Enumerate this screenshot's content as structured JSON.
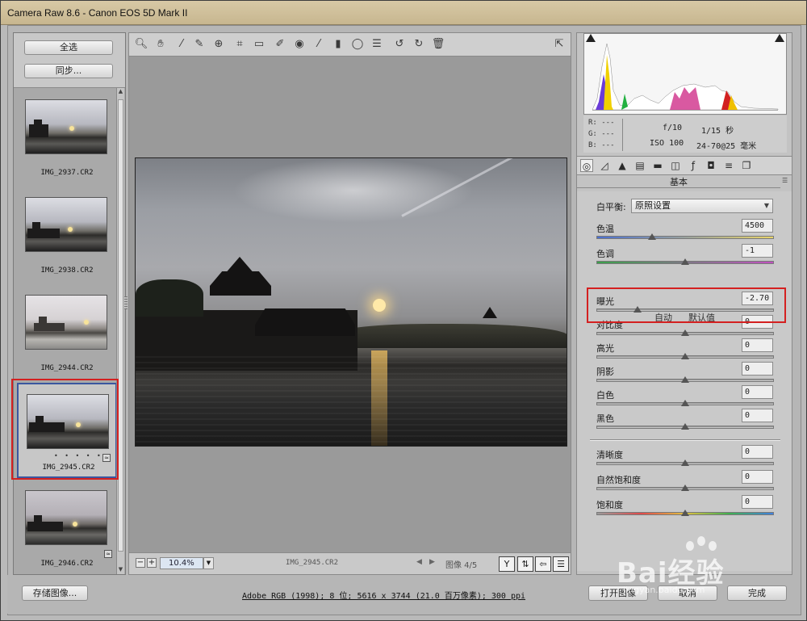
{
  "window": {
    "title": "Camera Raw 8.6 -  Canon EOS 5D Mark II"
  },
  "filmstrip": {
    "select_all_label": "全选",
    "sync_label": "同步...",
    "items": [
      {
        "name": "IMG_2937.CR2",
        "selected": false
      },
      {
        "name": "IMG_2938.CR2",
        "selected": false
      },
      {
        "name": "IMG_2944.CR2",
        "selected": false
      },
      {
        "name": "IMG_2945.CR2",
        "selected": true,
        "rating": "• • • • •"
      },
      {
        "name": "IMG_2946.CR2",
        "selected": false
      }
    ]
  },
  "toolbar": {
    "tools": [
      "zoom-tool",
      "hand-tool",
      "white-balance-tool",
      "color-sampler-tool",
      "targeted-adjustment-tool",
      "crop-tool",
      "straighten-tool",
      "spot-removal-tool",
      "red-eye-tool",
      "adjustment-brush",
      "graduated-filter",
      "radial-filter",
      "preferences",
      "rotate-left",
      "rotate-right",
      "delete"
    ]
  },
  "preview": {
    "zoom_value": "10.4%",
    "filename": "IMG_2945.CR2",
    "image_count": "图像 4/5"
  },
  "histogram": {
    "r": "R:  ---",
    "g": "G:  ---",
    "b": "B:  ---",
    "aperture": "f/10",
    "shutter": "1/15 秒",
    "iso": "ISO 100",
    "lens": "24-70@25 毫米"
  },
  "panel": {
    "title": "基本",
    "white_balance_label": "白平衡:",
    "white_balance_value": "原照设置",
    "temp_label": "色温",
    "temp_value": "4500",
    "tint_label": "色调",
    "tint_value": "-1",
    "auto_label": "自动",
    "default_label": "默认值",
    "exposure_label": "曝光",
    "exposure_value": "-2.70",
    "contrast_label": "对比度",
    "contrast_value": "0",
    "highlights_label": "高光",
    "highlights_value": "0",
    "shadows_label": "阴影",
    "shadows_value": "0",
    "whites_label": "白色",
    "whites_value": "0",
    "blacks_label": "黑色",
    "blacks_value": "0",
    "clarity_label": "清晰度",
    "clarity_value": "0",
    "vibrance_label": "自然饱和度",
    "vibrance_value": "0",
    "saturation_label": "饱和度",
    "saturation_value": "0"
  },
  "footer": {
    "save_label": "存储图像...",
    "info": "Adobe RGB (1998); 8 位; 5616 x 3744 (21.0 百万像素); 300 ppi",
    "open_label": "打开图像",
    "cancel_label": "取消",
    "done_label": "完成"
  },
  "watermark": {
    "text": "Bai经验",
    "sub": "jingyan.baidu.com"
  }
}
